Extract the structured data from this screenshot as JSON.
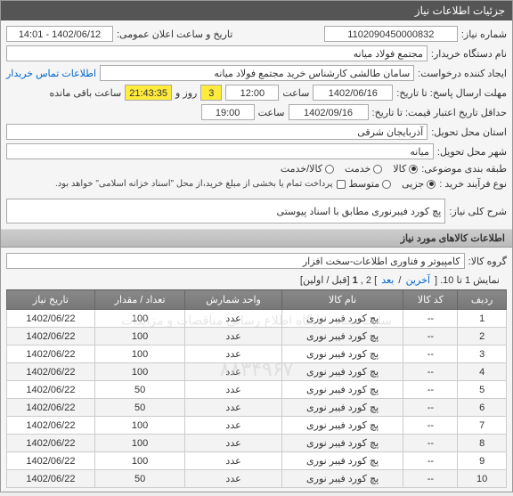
{
  "window": {
    "title": "جزئیات اطلاعات نیاز"
  },
  "form": {
    "need_no_label": "شماره نیاز:",
    "need_no": "1102090450000832",
    "announce_label": "تاریخ و ساعت اعلان عمومی:",
    "announce_value": "1402/06/12 - 14:01",
    "buyer_label": "نام دستگاه خریدار:",
    "buyer_value": "مجتمع فولاد میانه",
    "requester_label": "ایجاد کننده درخواست:",
    "requester_value": "سامان طالشی کارشناس خرید مجتمع فولاد میانه",
    "contact_link": "اطلاعات تماس خریدار",
    "reply_deadline_label": "مهلت ارسال پاسخ: تا تاریخ:",
    "reply_date": "1402/06/16",
    "time_label": "ساعت",
    "reply_time": "12:00",
    "days_left_prefix": "",
    "days_left_num": "3",
    "days_left_unit": "روز و",
    "time_left": "21:43:35",
    "time_left_suffix": "ساعت باقی مانده",
    "validity_label": "حداقل تاریخ اعتبار قیمت: تا تاریخ:",
    "validity_date": "1402/09/16",
    "validity_time": "19:00",
    "province_label": "استان محل تحویل:",
    "province_value": "آذربایجان شرقی",
    "city_label": "شهر محل تحویل:",
    "city_value": "میانه",
    "category_label": "طبقه بندی موضوعی:",
    "cat_goods": "کالا",
    "cat_service": "خدمت",
    "cat_both": "کالا/خدمت",
    "purchase_type_label": "نوع فرآیند خرید :",
    "pt_small": "جزیی",
    "pt_medium": "متوسط",
    "payment_note": "پرداخت تمام یا بخشی از مبلغ خرید،از محل \"اسناد خزانه اسلامی\" خواهد بود.",
    "desc_label": "شرح کلی نیاز:",
    "desc_value": "پچ کورد فیبرنوری مطابق با اسناد پیوستی"
  },
  "sections": {
    "goods_info": "اطلاعات کالاهای مورد نیاز",
    "group_label": "گروه کالا:",
    "group_value": "کامپیوتر و فناوری اطلاعات-سخت افزار"
  },
  "pager": {
    "text_prefix": "نمایش 1 تا 10. [",
    "last": "آخرین",
    "sep1": " / ",
    "next": "بعد",
    "mid": "] 2 ,",
    "current": "1",
    "suffix": "[قبل / اولین]"
  },
  "table": {
    "headers": [
      "ردیف",
      "کد کالا",
      "نام کالا",
      "واحد شمارش",
      "تعداد / مقدار",
      "تاریخ نیاز"
    ],
    "rows": [
      {
        "n": "1",
        "code": "--",
        "name": "پچ کورد فیبر نوری",
        "unit": "عدد",
        "qty": "100",
        "date": "1402/06/22"
      },
      {
        "n": "2",
        "code": "--",
        "name": "پچ کورد فیبر نوری",
        "unit": "عدد",
        "qty": "100",
        "date": "1402/06/22"
      },
      {
        "n": "3",
        "code": "--",
        "name": "پچ کورد فیبر نوری",
        "unit": "عدد",
        "qty": "100",
        "date": "1402/06/22"
      },
      {
        "n": "4",
        "code": "--",
        "name": "پچ کورد فیبر نوری",
        "unit": "عدد",
        "qty": "100",
        "date": "1402/06/22"
      },
      {
        "n": "5",
        "code": "--",
        "name": "پچ کورد فیبر نوری",
        "unit": "عدد",
        "qty": "50",
        "date": "1402/06/22"
      },
      {
        "n": "6",
        "code": "--",
        "name": "پچ کورد فیبر نوری",
        "unit": "عدد",
        "qty": "50",
        "date": "1402/06/22"
      },
      {
        "n": "7",
        "code": "--",
        "name": "پچ کورد فیبر نوری",
        "unit": "عدد",
        "qty": "100",
        "date": "1402/06/22"
      },
      {
        "n": "8",
        "code": "--",
        "name": "پچ کورد فیبر نوری",
        "unit": "عدد",
        "qty": "100",
        "date": "1402/06/22"
      },
      {
        "n": "9",
        "code": "--",
        "name": "پچ کورد فیبر نوری",
        "unit": "عدد",
        "qty": "100",
        "date": "1402/06/22"
      },
      {
        "n": "10",
        "code": "--",
        "name": "پچ کورد فیبر نوری",
        "unit": "عدد",
        "qty": "50",
        "date": "1402/06/22"
      }
    ]
  },
  "watermark": {
    "line1": "سایت ستاد - پایگاه اطلاع رسانی مناقصات و مزایدات",
    "line2": "۸۸۳۴۹۶۷"
  }
}
